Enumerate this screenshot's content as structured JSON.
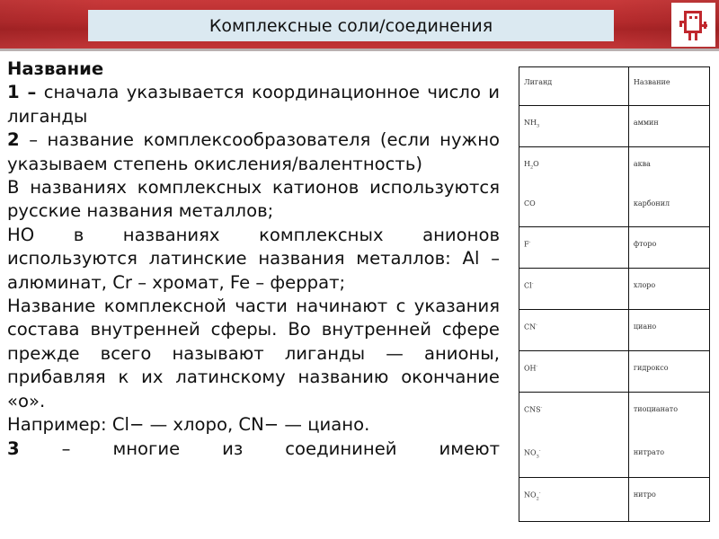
{
  "slide": {
    "title": "Комплексные соли/соединения",
    "logo_icon": "robot-logo-icon",
    "colors": {
      "header_red": "#b52a2c",
      "title_box_bg": "#dbe9f1",
      "logo_red": "#c0272d"
    }
  },
  "body": {
    "heading": "Название",
    "step1": {
      "num": "1 –",
      "text": "сначала указывается координационное число и лиганды"
    },
    "step2": {
      "num": "2",
      "text": "– название комплексообразователя (если нужно указываем степень окисления/валентность)"
    },
    "cations": "В названиях комплексных катионов используются русские названия металлов;",
    "anions": "НО в названиях комплексных анионов используются латинские названия металлов: Al –алюминат, Cr – хромат, Fe – феррат;",
    "complex_part": "Название комплексной части начинают с указания состава внутренней сферы. Во внутренней сфере прежде всего называют лиганды — анионы, прибавляя к их латинскому названию окончание «о».",
    "example": "Например: Cl− — хлоро, CN− — циано.",
    "step3": {
      "num": "3",
      "text": "– многие из соедининей имеют"
    }
  },
  "ligand_table": {
    "headers": [
      "Лиганд",
      "Название"
    ],
    "rows": [
      {
        "ligand": "NH",
        "sub": "3",
        "sup": "",
        "name": "аммин"
      },
      {
        "ligand": "H",
        "sub": "2",
        "rest": "O",
        "sup": "",
        "name": "аква"
      },
      {
        "ligand": "CO",
        "sub": "",
        "sup": "",
        "name": "карбонил"
      },
      {
        "ligand": "F",
        "sub": "",
        "sup": "-",
        "name": "фторо"
      },
      {
        "ligand": "Cl",
        "sub": "",
        "sup": "-",
        "name": "хлоро"
      },
      {
        "ligand": "CN",
        "sub": "",
        "sup": "-",
        "name": "циано"
      },
      {
        "ligand": "OH",
        "sub": "",
        "sup": "-",
        "name": "гидроксо"
      },
      {
        "ligand": "CNS",
        "sub": "",
        "sup": "-",
        "name": "тиоцианато"
      },
      {
        "ligand": "NO",
        "sub": "3",
        "sup": "-",
        "name": "нитрато"
      },
      {
        "ligand": "NO",
        "sub": "2",
        "sup": "-",
        "name": "нитро"
      }
    ]
  }
}
